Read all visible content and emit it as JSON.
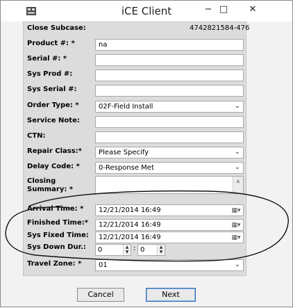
{
  "window": {
    "title": "iCE Client",
    "minimize": "−",
    "maximize": "□",
    "close": "✕"
  },
  "header": {
    "label": "Close Subcase:",
    "value": "4742821584-476"
  },
  "fields": {
    "product": {
      "label": "Product #: *",
      "value": "na"
    },
    "serial": {
      "label": "Serial #: *",
      "value": ""
    },
    "sys_prod": {
      "label": "Sys Prod #:",
      "value": ""
    },
    "sys_serial": {
      "label": "Sys Serial #:",
      "value": ""
    },
    "order_type": {
      "label": "Order Type: *",
      "value": "02F-Field Install"
    },
    "service_note": {
      "label": "Service Note:",
      "value": ""
    },
    "ctn": {
      "label": "CTN:",
      "value": ""
    },
    "repair_class": {
      "label": "Repair Class:*",
      "value": "Please Specify"
    },
    "delay_code": {
      "label": "Delay Code: *",
      "value": "0-Response Met"
    },
    "closing_summary": {
      "label_line1": "Closing",
      "label_line2": "Summary: *",
      "value": ""
    },
    "arrival_time": {
      "label": "Arrival Time: *",
      "value": "12/21/2014 16:49"
    },
    "finished_time": {
      "label": "Finished Time:*",
      "value": "12/21/2014 16:49"
    },
    "sys_fixed_time": {
      "label": "Sys Fixed Time:",
      "value": "12/21/2014 16:49"
    },
    "sys_down_dur": {
      "label": "Sys Down Dur.:",
      "hours": "0",
      "separator": ":",
      "minutes": "0"
    },
    "travel_zone": {
      "label": "Travel Zone: *",
      "value": "01"
    }
  },
  "buttons": {
    "cancel": "Cancel",
    "next": "Next"
  },
  "icons": {
    "dropdown": "chevron-down-icon",
    "calendar": "calendar-icon",
    "spinner": "spinner-arrows-icon"
  }
}
